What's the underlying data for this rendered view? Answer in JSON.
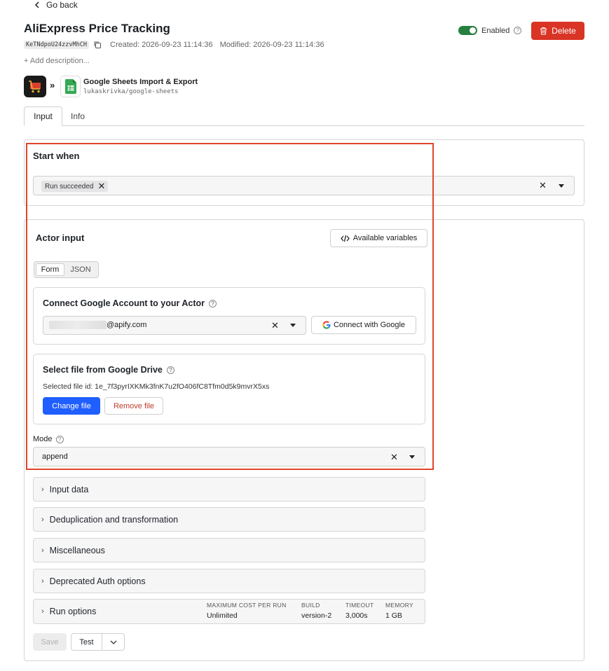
{
  "nav": {
    "go_back": "Go back"
  },
  "task": {
    "title": "AliExpress Price Tracking",
    "id": "KeTNdpoU24zzvMhCH",
    "created": "Created: 2026-09-23 11:14:36",
    "modified": "Modified: 2026-09-23 11:14:36",
    "add_description": "+ Add description..."
  },
  "status": {
    "enabled_label": "Enabled",
    "enabled": true,
    "toggle_color": "#27803f"
  },
  "actions": {
    "delete_label": "Delete",
    "delete_color": "#d93425"
  },
  "actor": {
    "name": "Google Sheets Import & Export",
    "slug": "lukaskrivka/google-sheets",
    "separator": "»"
  },
  "tabs": [
    {
      "label": "Input",
      "active": true
    },
    {
      "label": "Info",
      "active": false
    }
  ],
  "start_when": {
    "heading": "Start when",
    "chips": [
      "Run succeeded"
    ]
  },
  "actor_input": {
    "heading": "Actor input",
    "available_variables": "Available variables",
    "segments": [
      "Form",
      "JSON"
    ],
    "google_account": {
      "title": "Connect Google Account to your Actor",
      "value_suffix": "@apify.com",
      "connect_button": "Connect with Google"
    },
    "drive_file": {
      "title": "Select file from Google Drive",
      "file_id": "Selected file id: 1e_7f3pyrIXKMk3fnK7u2fO406fC8Tfm0d5k9mvrX5xs",
      "change_button": "Change file",
      "remove_button": "Remove file"
    },
    "mode": {
      "label": "Mode",
      "value": "append"
    },
    "sections": [
      "Input data",
      "Deduplication and transformation",
      "Miscellaneous",
      "Deprecated Auth options"
    ],
    "run_options": {
      "label": "Run options",
      "max_cost_label": "MAXIMUM COST PER RUN",
      "max_cost_value": "Unlimited",
      "build_label": "BUILD",
      "build_value": "version-2",
      "timeout_label": "TIMEOUT",
      "timeout_value": "3,000s",
      "memory_label": "MEMORY",
      "memory_value": "1 GB"
    }
  },
  "footer": {
    "save_label": "Save",
    "test_label": "Test"
  },
  "accent": {
    "primary_button": "#1f5eff",
    "highlight_box": "#e0452e"
  }
}
